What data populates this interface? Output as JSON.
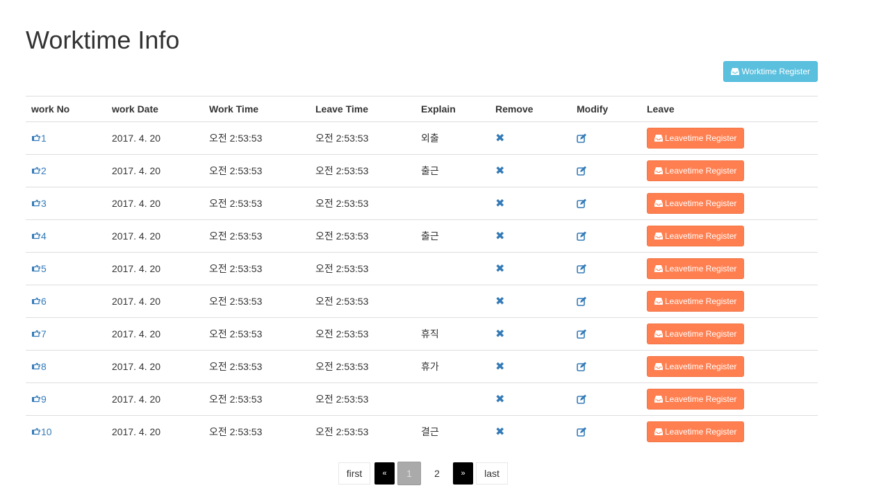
{
  "page": {
    "title": "Worktime Info"
  },
  "toolbar": {
    "register_label": "Worktime Register",
    "register_icon": "inbox-icon"
  },
  "table": {
    "headers": [
      "work No",
      "work Date",
      "Work Time",
      "Leave Time",
      "Explain",
      "Remove",
      "Modify",
      "Leave"
    ],
    "rows": [
      {
        "no": "1",
        "date": "2017. 4. 20",
        "work_time": "오전 2:53:53",
        "leave_time": "오전 2:53:53",
        "explain": "외출",
        "leave_label": "Leavetime Register"
      },
      {
        "no": "2",
        "date": "2017. 4. 20",
        "work_time": "오전 2:53:53",
        "leave_time": "오전 2:53:53",
        "explain": "출근",
        "leave_label": "Leavetime Register"
      },
      {
        "no": "3",
        "date": "2017. 4. 20",
        "work_time": "오전 2:53:53",
        "leave_time": "오전 2:53:53",
        "explain": "",
        "leave_label": "Leavetime Register"
      },
      {
        "no": "4",
        "date": "2017. 4. 20",
        "work_time": "오전 2:53:53",
        "leave_time": "오전 2:53:53",
        "explain": "출근",
        "leave_label": "Leavetime Register"
      },
      {
        "no": "5",
        "date": "2017. 4. 20",
        "work_time": "오전 2:53:53",
        "leave_time": "오전 2:53:53",
        "explain": "",
        "leave_label": "Leavetime Register"
      },
      {
        "no": "6",
        "date": "2017. 4. 20",
        "work_time": "오전 2:53:53",
        "leave_time": "오전 2:53:53",
        "explain": "",
        "leave_label": "Leavetime Register"
      },
      {
        "no": "7",
        "date": "2017. 4. 20",
        "work_time": "오전 2:53:53",
        "leave_time": "오전 2:53:53",
        "explain": "휴직",
        "leave_label": "Leavetime Register"
      },
      {
        "no": "8",
        "date": "2017. 4. 20",
        "work_time": "오전 2:53:53",
        "leave_time": "오전 2:53:53",
        "explain": "휴가",
        "leave_label": "Leavetime Register"
      },
      {
        "no": "9",
        "date": "2017. 4. 20",
        "work_time": "오전 2:53:53",
        "leave_time": "오전 2:53:53",
        "explain": "",
        "leave_label": "Leavetime Register"
      },
      {
        "no": "10",
        "date": "2017. 4. 20",
        "work_time": "오전 2:53:53",
        "leave_time": "오전 2:53:53",
        "explain": "결근",
        "leave_label": "Leavetime Register"
      }
    ],
    "icons": {
      "no": "hand-point-icon",
      "remove": "remove-icon",
      "modify": "edit-icon",
      "leave": "inbox-icon"
    },
    "remove_glyph": "✖"
  },
  "pagination": {
    "first": "first",
    "prev": "«",
    "pages": [
      "1",
      "2"
    ],
    "active": "1",
    "next": "»",
    "last": "last"
  },
  "colors": {
    "info": "#5bc0de",
    "leave_button": "#ff7f50",
    "link": "#337ab7",
    "active_page": "#aaaaaa"
  }
}
